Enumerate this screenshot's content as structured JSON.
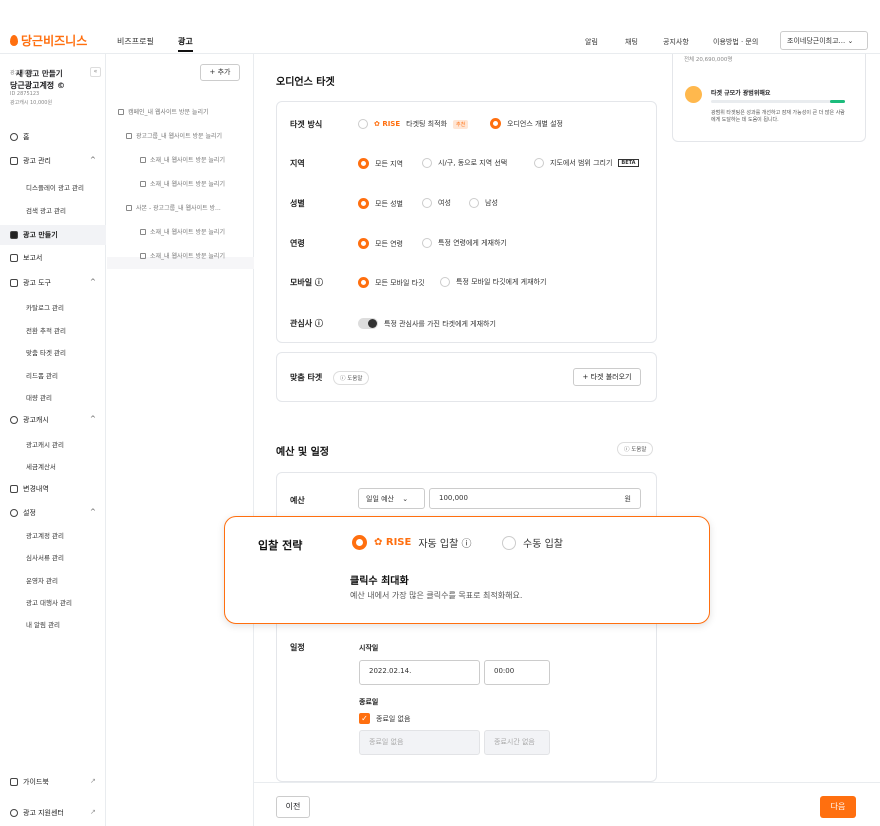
{
  "header": {
    "logo": "당근비즈니스",
    "nav": [
      "비즈프로필",
      "광고"
    ],
    "top_links": [
      "알림",
      "채팅",
      "공지사항",
      "이용방법 · 문의"
    ],
    "account": "조이네당근이최고..."
  },
  "sidebar": {
    "account_type": "광고계정 C",
    "account_name": "당근광고계정 ©",
    "account_id": "ID 2875123",
    "balance": "광고캐시 10,000원",
    "home": "홈",
    "ad_manage": "광고 관리",
    "ad_manage_items": [
      "디스플레이 광고 관리",
      "검색 광고 관리"
    ],
    "create_ad": "광고 만들기",
    "report": "보고서",
    "ad_tools": "광고 도구",
    "ad_tools_items": [
      "카탈로그 관리",
      "전환 추적 관리",
      "맞춤 타겟 관리",
      "리드폼 관리",
      "대량 관리"
    ],
    "ad_cash": "광고캐시",
    "ad_cash_items": [
      "광고캐시 관리",
      "세금계산서"
    ],
    "history": "변경내역",
    "settings": "설정",
    "settings_items": [
      "광고계정 관리",
      "심사서류 관리",
      "운영자 관리",
      "광고 대행사 관리",
      "내 알림 관리"
    ],
    "guidebook": "가이드북",
    "support": "광고 지원센터"
  },
  "tree": {
    "title": "새 광고 만들기",
    "add": "+ 추가",
    "items": [
      "캠페인_내 웹사이트 방문 늘리기",
      "광고그룹_내 웹사이트 방문 늘리기",
      "소재_내 웹사이트 방문 늘리기",
      "소재_내 웹사이트 방문 늘리기",
      "사본 - 광고그룹_내 웹사이트 방...",
      "소재_내 웹사이트 방문 늘리기",
      "소재_내 웹사이트 방문 늘리기"
    ]
  },
  "audience": {
    "title": "오디언스 타겟",
    "method_label": "타겟 방식",
    "rise": "RISE",
    "rise_opt": "타겟팅 최적화",
    "rise_badge": "추천",
    "custom_opt": "오디언스 개별 설정",
    "region_label": "지역",
    "region_opts": [
      "모든 지역",
      "시/구, 동으로 지역 선택",
      "지도에서 범위 그리기"
    ],
    "map_badge": "BETA",
    "gender_label": "성별",
    "gender_opts": [
      "모든 성별",
      "여성",
      "남성"
    ],
    "age_label": "연령",
    "age_opts": [
      "모든 연령",
      "특정 연령에게 게재하기"
    ],
    "mobile_label": "모바일 ⓘ",
    "mobile_opts": [
      "모든 모바일 타깃",
      "특정 모바일 타깃에게 게재하기"
    ],
    "interest_label": "관심사 ⓘ",
    "interest_text": "특정 관심사를 가진 타겟에게 게재하기",
    "custom_target_label": "맞춤 타겟",
    "help": "ⓘ 도움말",
    "load_target": "+ 타겟 불러오기"
  },
  "budget": {
    "title": "예산 및 일정",
    "help": "ⓘ 도움말",
    "budget_label": "예산",
    "budget_type": "일일 예산",
    "budget_value": "100,000",
    "currency": "원",
    "schedule_label": "일정",
    "start_label": "시작일",
    "start_date": "2022.02.14.",
    "start_time": "00:00",
    "end_label": "종료일",
    "no_end": "종료일 없음",
    "end_date_placeholder": "종료일 없음",
    "end_time_placeholder": "종료시간 없음"
  },
  "popup": {
    "label": "입찰 전략",
    "rise": "RISE",
    "auto": "자동 입찰 ⓘ",
    "manual": "수동 입찰",
    "heading": "클릭수 최대화",
    "desc": "예산 내에서 가장 많은 클릭수를 목표로 최적화해요."
  },
  "right_panel": {
    "top": "전체 20,690,000명",
    "title": "타겟 규모가 광범위해요",
    "desc": "광범위 타겟팅은 성과를 개선하고 잠재 가능성이 큰 더 많은 사람에게 도달하는 데 도움이 됩니다.",
    "fill_fraction": 0.9
  },
  "footer": {
    "prev": "이전",
    "next": "다음"
  },
  "colors": {
    "accent": "#ff6f0f",
    "good": "#1bbc7c"
  }
}
